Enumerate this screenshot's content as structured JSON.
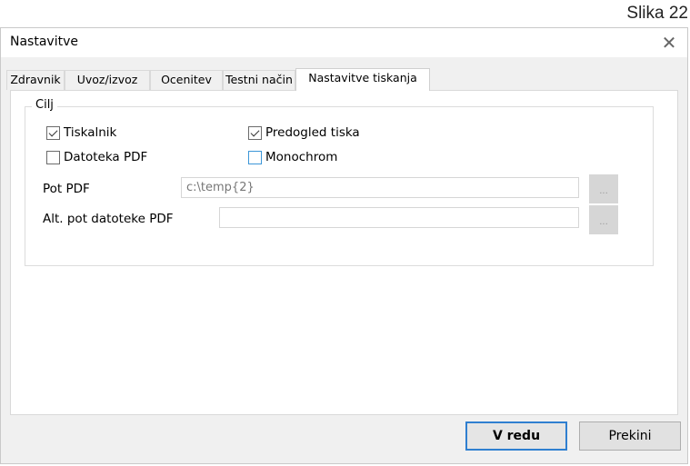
{
  "figure_label": "Slika 22",
  "window": {
    "title": "Nastavitve",
    "close_glyph": "✕"
  },
  "tabs": [
    {
      "label": "Zdravnik",
      "active": false
    },
    {
      "label": "Uvoz/izvoz",
      "active": false
    },
    {
      "label": "Ocenitev",
      "active": false
    },
    {
      "label": "Testni način",
      "active": false
    },
    {
      "label": "Nastavitve tiskanja",
      "active": true
    }
  ],
  "group": {
    "legend": "Cilj",
    "checkboxes": {
      "printer": {
        "label": "Tiskalnik",
        "checked": true
      },
      "print_preview": {
        "label": "Predogled tiska",
        "checked": true
      },
      "pdf_file": {
        "label": "Datoteka PDF",
        "checked": false
      },
      "monochrome": {
        "label": "Monochrom",
        "checked": false
      }
    },
    "pdf_path": {
      "label": "Pot PDF",
      "value": "c:\\temp{2}",
      "browse": "..."
    },
    "alt_pdf_path": {
      "label": "Alt. pot datoteke PDF",
      "value": "",
      "browse": "..."
    }
  },
  "buttons": {
    "ok": "V redu",
    "cancel": "Prekini"
  },
  "colors": {
    "accent": "#2f7fd0",
    "focus_checkbox": "#3c96d8"
  }
}
